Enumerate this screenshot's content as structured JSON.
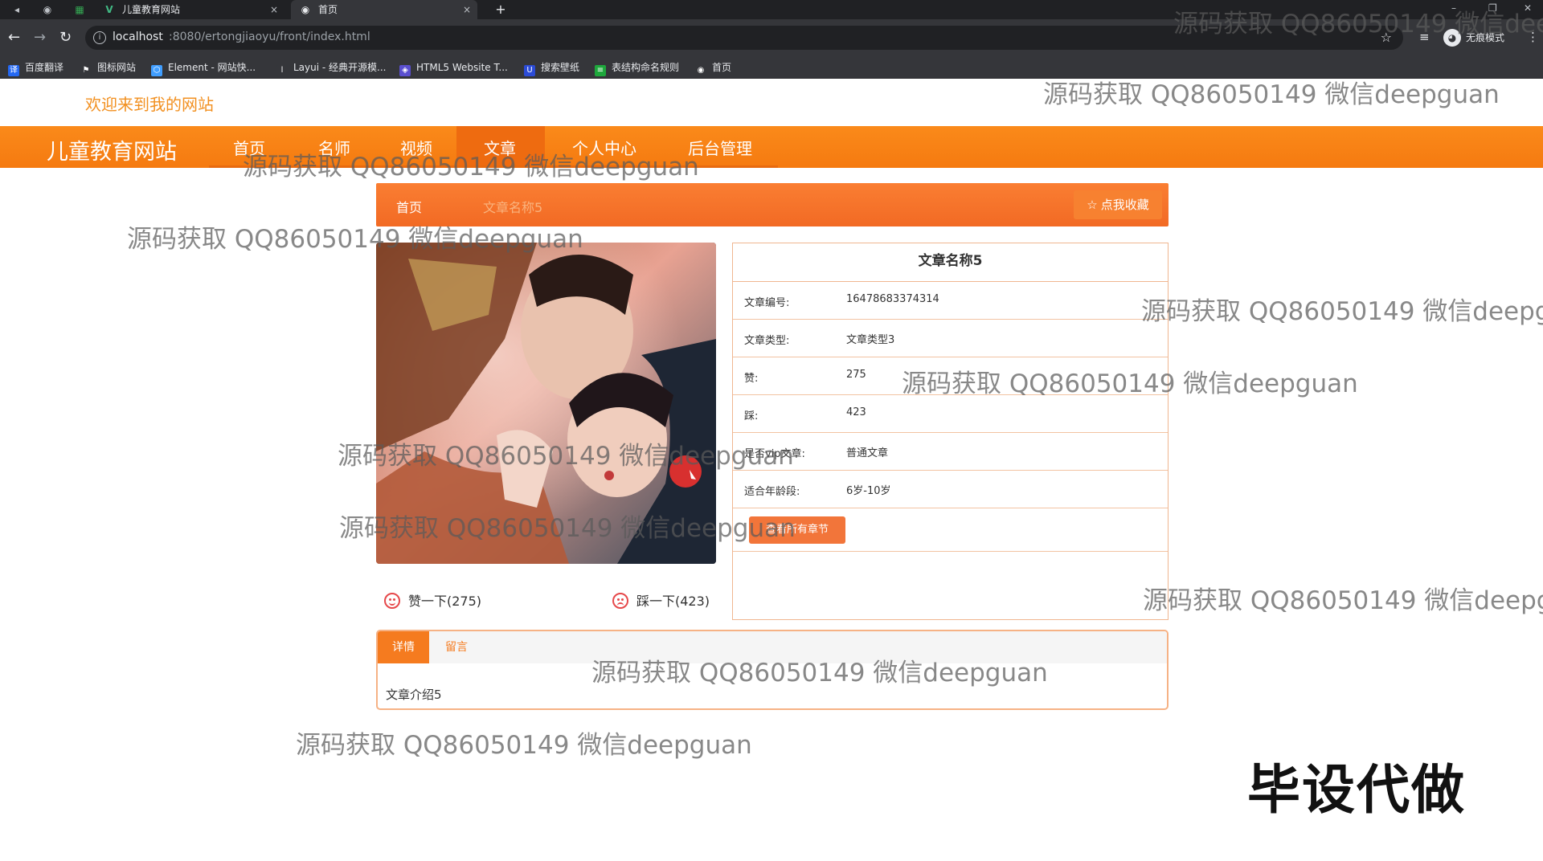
{
  "browser": {
    "tabs": [
      {
        "title": "儿童教育网站",
        "close": "×"
      },
      {
        "title": "首页",
        "close": "×"
      }
    ],
    "new_tab": "+",
    "url_host": "localhost",
    "url_path": ":8080/ertongjiaoyu/front/index.html",
    "incognito_label": "无痕模式",
    "bookmarks": [
      "百度翻译",
      "图标网站",
      "Element - 网站快...",
      "Layui - 经典开源模...",
      "HTML5 Website T...",
      "搜索壁纸",
      "表结构命名规则",
      "首页"
    ]
  },
  "site": {
    "welcome": "欢迎来到我的网站",
    "brand": "儿童教育网站",
    "nav": [
      "首页",
      "名师",
      "视频",
      "文章",
      "个人中心",
      "后台管理"
    ],
    "breadcrumb": {
      "home": "首页",
      "current": "文章名称5"
    },
    "favorite_button": "点我收藏",
    "favorite_icon": "☆"
  },
  "article": {
    "title": "文章名称5",
    "fields": [
      {
        "label": "文章编号:",
        "value": "16478683374314"
      },
      {
        "label": "文章类型:",
        "value": "文章类型3"
      },
      {
        "label": "赞:",
        "value": "275"
      },
      {
        "label": "踩:",
        "value": "423"
      },
      {
        "label": "是否vip文章:",
        "value": "普通文章"
      },
      {
        "label": "适合年龄段:",
        "value": "6岁-10岁"
      }
    ],
    "chapters_button": "查看所有章节",
    "like_label": "赞一下(275)",
    "dislike_label": "踩一下(423)",
    "tabs": [
      "详情",
      "留言"
    ],
    "intro": "文章介绍5"
  },
  "overlay": {
    "watermark": "源码获取 QQ86050149 微信deepguan",
    "tag": "毕设代做"
  },
  "colors": {
    "accent": "#f57b1f",
    "nav_bg": "#f78616",
    "browser_dark": "#202124"
  }
}
